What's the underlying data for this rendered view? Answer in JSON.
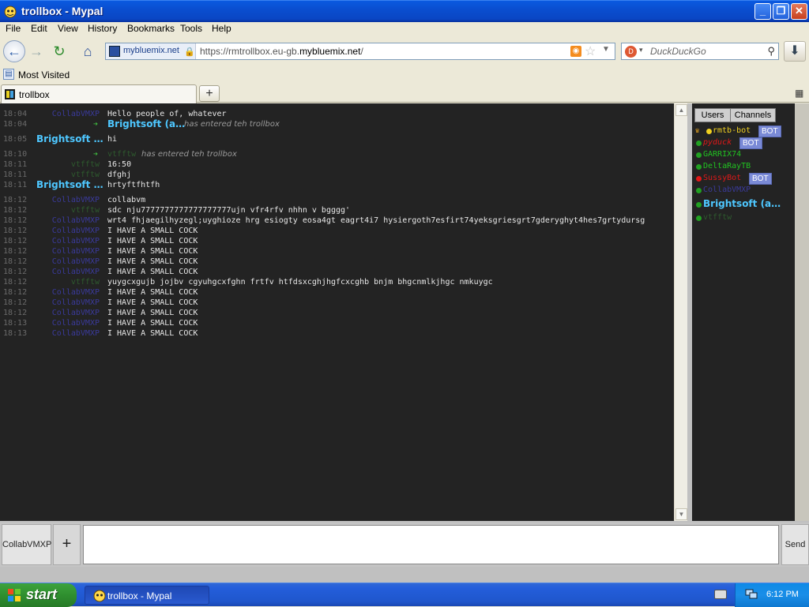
{
  "window": {
    "title": "trollbox - Mypal"
  },
  "menu": [
    "File",
    "Edit",
    "View",
    "History",
    "Bookmarks",
    "Tools",
    "Help"
  ],
  "toolbar": {
    "identity_domain": "mybluemix.net",
    "url_prefix": "https://rmtrollbox.eu-gb.",
    "url_domain": "mybluemix.net",
    "url_suffix": "/",
    "search_placeholder": "DuckDuckGo"
  },
  "bookmarks": {
    "most_visited": "Most Visited"
  },
  "tabs": [
    {
      "label": "trollbox"
    }
  ],
  "chat": {
    "messages": [
      {
        "time": "18:04",
        "nick": "CollabVMXP",
        "text": "Hello people of, whatever"
      },
      {
        "time": "18:04",
        "join": "Brightsoft (a…",
        "join_text": "has entered teh trollbox"
      },
      {
        "time": "18:05",
        "nick_bs": "Brightsoft …",
        "text": "hi"
      },
      {
        "time": "18:10",
        "join": "vtfftw",
        "join_text": "has entered teh trollbox"
      },
      {
        "time": "18:11",
        "nick": "vtfftw",
        "nick_green": true,
        "text": "16:50"
      },
      {
        "time": "18:11",
        "nick": "vtfftw",
        "nick_green": true,
        "text": "dfghj"
      },
      {
        "time": "18:11",
        "nick_bs": "Brightsoft …",
        "text": "hrtyftfhtfh"
      },
      {
        "time": "18:12",
        "nick": "CollabVMXP",
        "text": "collabvm"
      },
      {
        "time": "18:12",
        "nick": "vtfftw",
        "nick_green": true,
        "text": "sdc        nju7777777777777777777ujn  vfr4rfv  nhhn  v                bgggg'"
      },
      {
        "time": "18:12",
        "nick": "CollabVMXP",
        "text": "wrt4 fhjaegilhyzegl;uyghioze hrg esiogty eosa4gt eagrt4i7 hysiergoth7esfirt74yeksgriesgrt7gderyghyt4hes7grtydursg"
      },
      {
        "time": "18:12",
        "nick": "CollabVMXP",
        "text": "I HAVE A SMALL COCK"
      },
      {
        "time": "18:12",
        "nick": "CollabVMXP",
        "text": "I HAVE A SMALL COCK"
      },
      {
        "time": "18:12",
        "nick": "CollabVMXP",
        "text": "I HAVE A SMALL COCK"
      },
      {
        "time": "18:12",
        "nick": "CollabVMXP",
        "text": "I HAVE A SMALL COCK"
      },
      {
        "time": "18:12",
        "nick": "CollabVMXP",
        "text": "I HAVE A SMALL COCK"
      },
      {
        "time": "18:12",
        "nick": "vtfftw",
        "nick_green": true,
        "text": "yuygcxgujb jojbv cgyuhgcxfghn frtfv htfdsxcghjhgfcxcghb bnjm bhgcnmlkjhgc nmkuygc"
      },
      {
        "time": "18:12",
        "nick": "CollabVMXP",
        "text": "I HAVE A SMALL COCK"
      },
      {
        "time": "18:12",
        "nick": "CollabVMXP",
        "text": "I HAVE A SMALL COCK"
      },
      {
        "time": "18:12",
        "nick": "CollabVMXP",
        "text": "I HAVE A SMALL COCK"
      },
      {
        "time": "18:13",
        "nick": "CollabVMXP",
        "text": "I HAVE A SMALL COCK"
      },
      {
        "time": "18:13",
        "nick": "CollabVMXP",
        "text": "I HAVE A SMALL COCK"
      }
    ]
  },
  "sidebar": {
    "tabs": [
      "Users",
      "Channels"
    ],
    "users": [
      {
        "name": "rmtb-bot",
        "color": "#f0d020",
        "status": "yellow",
        "crown": true,
        "bot": true
      },
      {
        "name": "pyduck",
        "color": "#e01818",
        "status": "green",
        "italic": true,
        "bot": true
      },
      {
        "name": "GARRIX74",
        "color": "#21c221",
        "status": "green"
      },
      {
        "name": "DeltaRayTB",
        "color": "#21c221",
        "status": "green"
      },
      {
        "name": "SussyBot",
        "color": "#e01818",
        "status": "red",
        "bot": true
      },
      {
        "name": "CollabVMXP",
        "color": "#3a3a9a",
        "status": "green"
      },
      {
        "name": "Brightsoft (a…",
        "color": "#4ec7ff",
        "status": "green",
        "bold": true
      },
      {
        "name": "vtfftw",
        "color": "#2e5a2e",
        "status": "green"
      }
    ],
    "bot_label": "BOT"
  },
  "input": {
    "nick": "CollabVMXP",
    "add": "+",
    "send": "Send"
  },
  "taskbar": {
    "start": "start",
    "task": "trollbox - Mypal",
    "clock": "6:12 PM"
  }
}
